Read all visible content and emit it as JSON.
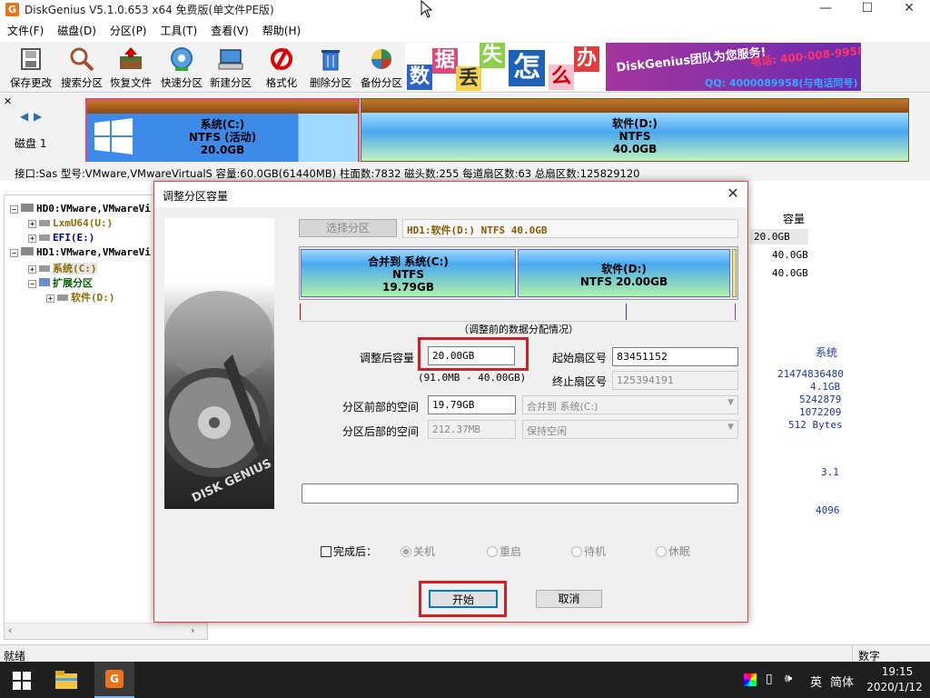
{
  "window": {
    "title": "DiskGenius V5.1.0.653 x64 免费版(单文件PE版)",
    "app_icon": "G"
  },
  "menu": [
    "文件(F)",
    "磁盘(D)",
    "分区(P)",
    "工具(T)",
    "查看(V)",
    "帮助(H)"
  ],
  "toolbar": [
    {
      "label": "保存更改",
      "icon": "save-icon"
    },
    {
      "label": "搜索分区",
      "icon": "magnifier-icon"
    },
    {
      "label": "恢复文件",
      "icon": "recover-icon"
    },
    {
      "label": "快速分区",
      "icon": "quick-partition-icon"
    },
    {
      "label": "新建分区",
      "icon": "new-partition-icon"
    },
    {
      "label": "格式化",
      "icon": "format-icon"
    },
    {
      "label": "删除分区",
      "icon": "delete-icon"
    },
    {
      "label": "备份分区",
      "icon": "backup-icon"
    }
  ],
  "banner": {
    "chars": [
      "数",
      "据",
      "丢",
      "失",
      "怎",
      "么",
      "办"
    ],
    "line1": "DiskGenius团队为您服务!",
    "phone": "电话: 400-008-9958",
    "qq": "QQ: 4000089958(与电话同号)"
  },
  "disk": {
    "label": "磁盘 1",
    "partitions": [
      {
        "line1": "系统(C:)",
        "line2": "NTFS (活动)",
        "line3": "20.0GB"
      },
      {
        "line1": "软件(D:)",
        "line2": "NTFS",
        "line3": "40.0GB"
      }
    ],
    "info": "接口:Sas  型号:VMware,VMwareVirtualS  容量:60.0GB(61440MB)  柱面数:7832  磁头数:255  每道扇区数:63  总扇区数:125829120"
  },
  "tree": [
    {
      "text": "HD0:VMware,VMwareVi",
      "color": "#000"
    },
    {
      "text": "LxmU64(U:)",
      "color": "#8a6d00"
    },
    {
      "text": "EFI(E:)",
      "color": "#00008b"
    },
    {
      "text": "HD1:VMware,VMwareVi",
      "color": "#000"
    },
    {
      "text": "系统(C:)",
      "color": "#8a6d00"
    },
    {
      "text": "扩展分区",
      "color": "#006400"
    },
    {
      "text": "软件(D:)",
      "color": "#8a6d00"
    }
  ],
  "right_panel": {
    "col_header": "容量",
    "capacities": [
      "20.0GB",
      "40.0GB",
      "40.0GB"
    ],
    "detail_header": "系统",
    "details": [
      "21474836480",
      "4.1GB",
      "5242879",
      "1072209",
      "512 Bytes",
      "3.1",
      "4096"
    ]
  },
  "status": {
    "left": "就绪",
    "right": "数字"
  },
  "taskbar": {
    "time": "19:15",
    "date": "2020/1/12",
    "ime1": "英",
    "ime2": "简体"
  },
  "dialog": {
    "title": "调整分区容量",
    "select_partition_btn": "选择分区",
    "selected_partition": "HD1:软件(D:) NTFS 40.0GB",
    "preview": [
      {
        "line1": "合并到 系统(C:)",
        "line2": "NTFS",
        "line3": "19.79GB"
      },
      {
        "line1": "软件(D:)",
        "line2": "NTFS 20.00GB",
        "line3": ""
      }
    ],
    "preview_caption": "（调整前的数据分配情况）",
    "size_label": "调整后容量",
    "size_value": "20.00GB",
    "size_range": "(91.0MB - 40.00GB)",
    "start_sector_label": "起始扇区号",
    "start_sector": "83451152",
    "end_sector_label": "终止扇区号",
    "end_sector": "125394191",
    "before_label": "分区前部的空间",
    "before_value": "19.79GB",
    "before_action": "合并到 系统(C:)",
    "after_label": "分区后部的空间",
    "after_value": "212.37MB",
    "after_action": "保持空闲",
    "after_done_label": "完成后：",
    "options": [
      "关机",
      "重启",
      "待机",
      "休眠"
    ],
    "start_btn": "开始",
    "cancel_btn": "取消"
  }
}
